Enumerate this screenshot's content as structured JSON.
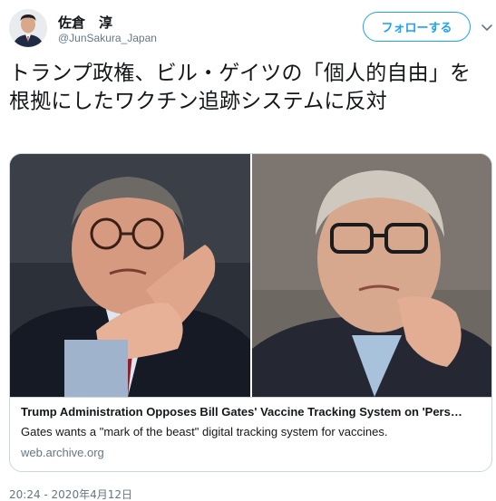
{
  "user": {
    "display_name": "佐倉　淳",
    "handle": "@JunSakura_Japan",
    "avatar_icon": "person-avatar"
  },
  "follow_button": {
    "label": "フォローする"
  },
  "menu": {
    "icon": "chevron-down-icon"
  },
  "tweet": {
    "text": "トランプ政権、ビル・ゲイツの「個人的自由」を根拠にしたワクチン追跡システムに反対",
    "timestamp": "20:24 - 2020年4月12日"
  },
  "card": {
    "title": "Trump Administration Opposes Bill Gates' Vaccine Tracking System on 'Pers…",
    "description": "Gates wants a \"mark of the beast\" digital tracking system for vaccines.",
    "domain": "web.archive.org"
  },
  "colors": {
    "accent": "#1da1f2",
    "secondary_text": "#657786",
    "border": "#ccd6dd"
  }
}
